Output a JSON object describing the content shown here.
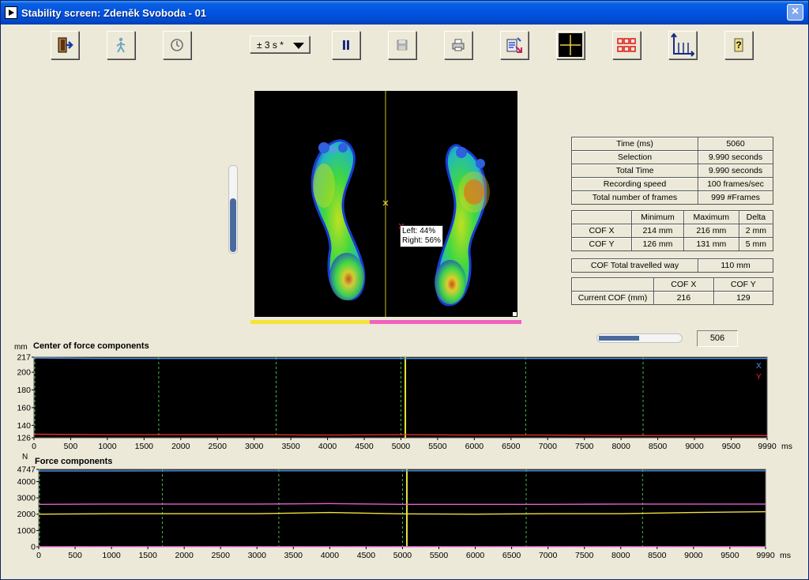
{
  "window": {
    "title": "Stability screen: Zdeněk Svoboda - 01",
    "close_label": "×"
  },
  "toolbar": {
    "exit_icon": "exit-icon",
    "walk_icon": "walking-person-icon",
    "clock_icon": "clock-icon",
    "time_window_value": "± 3 s *",
    "pause_icon": "pause-icon",
    "save_icon": "floppy-disk-icon",
    "print_icon": "printer-icon",
    "export_icon": "export-icon",
    "crosshair_icon": "crosshair-icon",
    "grid_icon": "grid-icon",
    "axes_icon": "axes-icon",
    "help_icon": "help-icon"
  },
  "foot_view": {
    "left_label": "Left: 44%",
    "right_label": "Right: 56%",
    "left_fraction": 0.44,
    "right_fraction": 0.56,
    "scale_fraction": 0.62,
    "colors": {
      "left": "#f6e33a",
      "right": "#f062c0"
    }
  },
  "info": {
    "rows": [
      {
        "label": "Time (ms)",
        "value": "5060"
      },
      {
        "label": "Selection",
        "value": "9.990 seconds"
      },
      {
        "label": "Total Time",
        "value": "9.990 seconds"
      },
      {
        "label": "Recording speed",
        "value": "100 frames/sec"
      },
      {
        "label": "Total number of frames",
        "value": "999 #Frames"
      }
    ]
  },
  "cof_stats": {
    "headers": [
      "",
      "Minimum",
      "Maximum",
      "Delta"
    ],
    "rows": [
      {
        "label": "COF X",
        "min": "214 mm",
        "max": "216 mm",
        "delta": "2 mm"
      },
      {
        "label": "COF Y",
        "min": "126 mm",
        "max": "131 mm",
        "delta": "5 mm"
      }
    ]
  },
  "travel": {
    "label": "COF Total travelled way",
    "value": "110 mm"
  },
  "current": {
    "headers": [
      "",
      "COF X",
      "COF Y"
    ],
    "label": "Current COF (mm)",
    "x": "216",
    "y": "129"
  },
  "frame_slider": {
    "value": "506",
    "fraction": 0.5
  },
  "chart_data": [
    {
      "type": "line",
      "title": "Center of force components",
      "ylabel": "mm",
      "xlabel": "ms",
      "xlim": [
        0,
        9990
      ],
      "ylim": [
        126,
        217
      ],
      "yticks": [
        126,
        140,
        160,
        180,
        200,
        217
      ],
      "xticks": [
        0,
        500,
        1000,
        1500,
        2000,
        2500,
        3000,
        3500,
        4000,
        4500,
        5000,
        5500,
        6000,
        6500,
        7000,
        7500,
        8000,
        8500,
        9000,
        9500,
        9990
      ],
      "markers": [
        1700,
        3300,
        5000,
        6700,
        8300
      ],
      "cursor": 5060,
      "legend": [
        "X",
        "Y"
      ],
      "series": [
        {
          "name": "X",
          "color": "#4a90e8",
          "x": [
            0,
            1000,
            2000,
            3000,
            4000,
            5000,
            6000,
            7000,
            8000,
            9000,
            9990
          ],
          "y": [
            216,
            215.5,
            215.5,
            215.5,
            215.5,
            215.5,
            215.5,
            215.5,
            215.5,
            215.5,
            215.5
          ]
        },
        {
          "name": "Y",
          "color": "#e8302a",
          "x": [
            0,
            1000,
            2000,
            3000,
            4000,
            5000,
            6000,
            7000,
            8000,
            9000,
            9990
          ],
          "y": [
            130,
            129.5,
            129.5,
            129.5,
            129,
            129.5,
            129,
            129,
            128.5,
            128.5,
            128.5
          ]
        }
      ]
    },
    {
      "type": "line",
      "title": "Force components",
      "ylabel": "N",
      "xlabel": "ms",
      "xlim": [
        0,
        9990
      ],
      "ylim": [
        0,
        4747
      ],
      "yticks": [
        0,
        1000,
        2000,
        3000,
        4000,
        4747
      ],
      "xticks": [
        0,
        500,
        1000,
        1500,
        2000,
        2500,
        3000,
        3500,
        4000,
        4500,
        5000,
        5500,
        6000,
        6500,
        7000,
        7500,
        8000,
        8500,
        9000,
        9500,
        9990
      ],
      "markers": [
        1700,
        3300,
        5000,
        6700,
        8300
      ],
      "cursor": 5060,
      "series": [
        {
          "color": "#4a90e8",
          "x": [
            0,
            1000,
            2000,
            3000,
            4000,
            5000,
            6000,
            7000,
            8000,
            9000,
            9990
          ],
          "y": [
            4650,
            4650,
            4660,
            4660,
            4660,
            4660,
            4660,
            4660,
            4660,
            4660,
            4660
          ]
        },
        {
          "color": "#e060d0",
          "x": [
            0,
            1000,
            2000,
            3000,
            4000,
            5000,
            6000,
            7000,
            8000,
            9000,
            9990
          ],
          "y": [
            2600,
            2620,
            2620,
            2620,
            2650,
            2600,
            2600,
            2600,
            2620,
            2620,
            2620
          ]
        },
        {
          "color": "#f0e040",
          "x": [
            0,
            1000,
            2000,
            3000,
            4000,
            5000,
            6000,
            7000,
            8000,
            9000,
            9990
          ],
          "y": [
            2000,
            2030,
            2030,
            2030,
            2100,
            2020,
            2000,
            2030,
            2030,
            2100,
            2150
          ]
        },
        {
          "color": "#e060d0",
          "x": [
            0,
            9990
          ],
          "y": [
            10,
            10
          ]
        }
      ]
    }
  ]
}
